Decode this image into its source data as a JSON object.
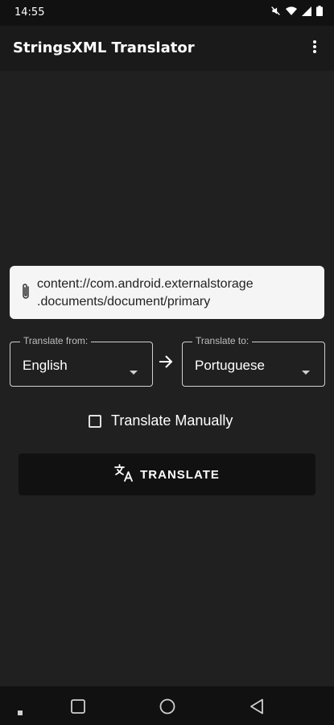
{
  "status_bar": {
    "time": "14:55"
  },
  "app_bar": {
    "title": "StringsXML Translator"
  },
  "file_path": {
    "line1": "content://com.android.externalstorage",
    "line2": ".documents/document/primary"
  },
  "translate_from": {
    "label": "Translate from:",
    "value": "English"
  },
  "translate_to": {
    "label": "Translate to:",
    "value": "Portuguese"
  },
  "manual": {
    "label": "Translate Manually",
    "checked": false
  },
  "translate_button": {
    "label": "TRANSLATE"
  },
  "icons": {
    "mute": "mute-icon",
    "wifi": "wifi-icon",
    "signal": "signal-icon",
    "battery": "battery-icon",
    "overflow": "more-vert-icon",
    "attachment": "paperclip-icon",
    "arrow": "arrow-right-icon",
    "dropdown": "dropdown-arrow-icon",
    "translate": "translate-icon"
  },
  "colors": {
    "background": "#202020",
    "field_bg": "#f5f5f5",
    "button_bg": "#111111"
  }
}
